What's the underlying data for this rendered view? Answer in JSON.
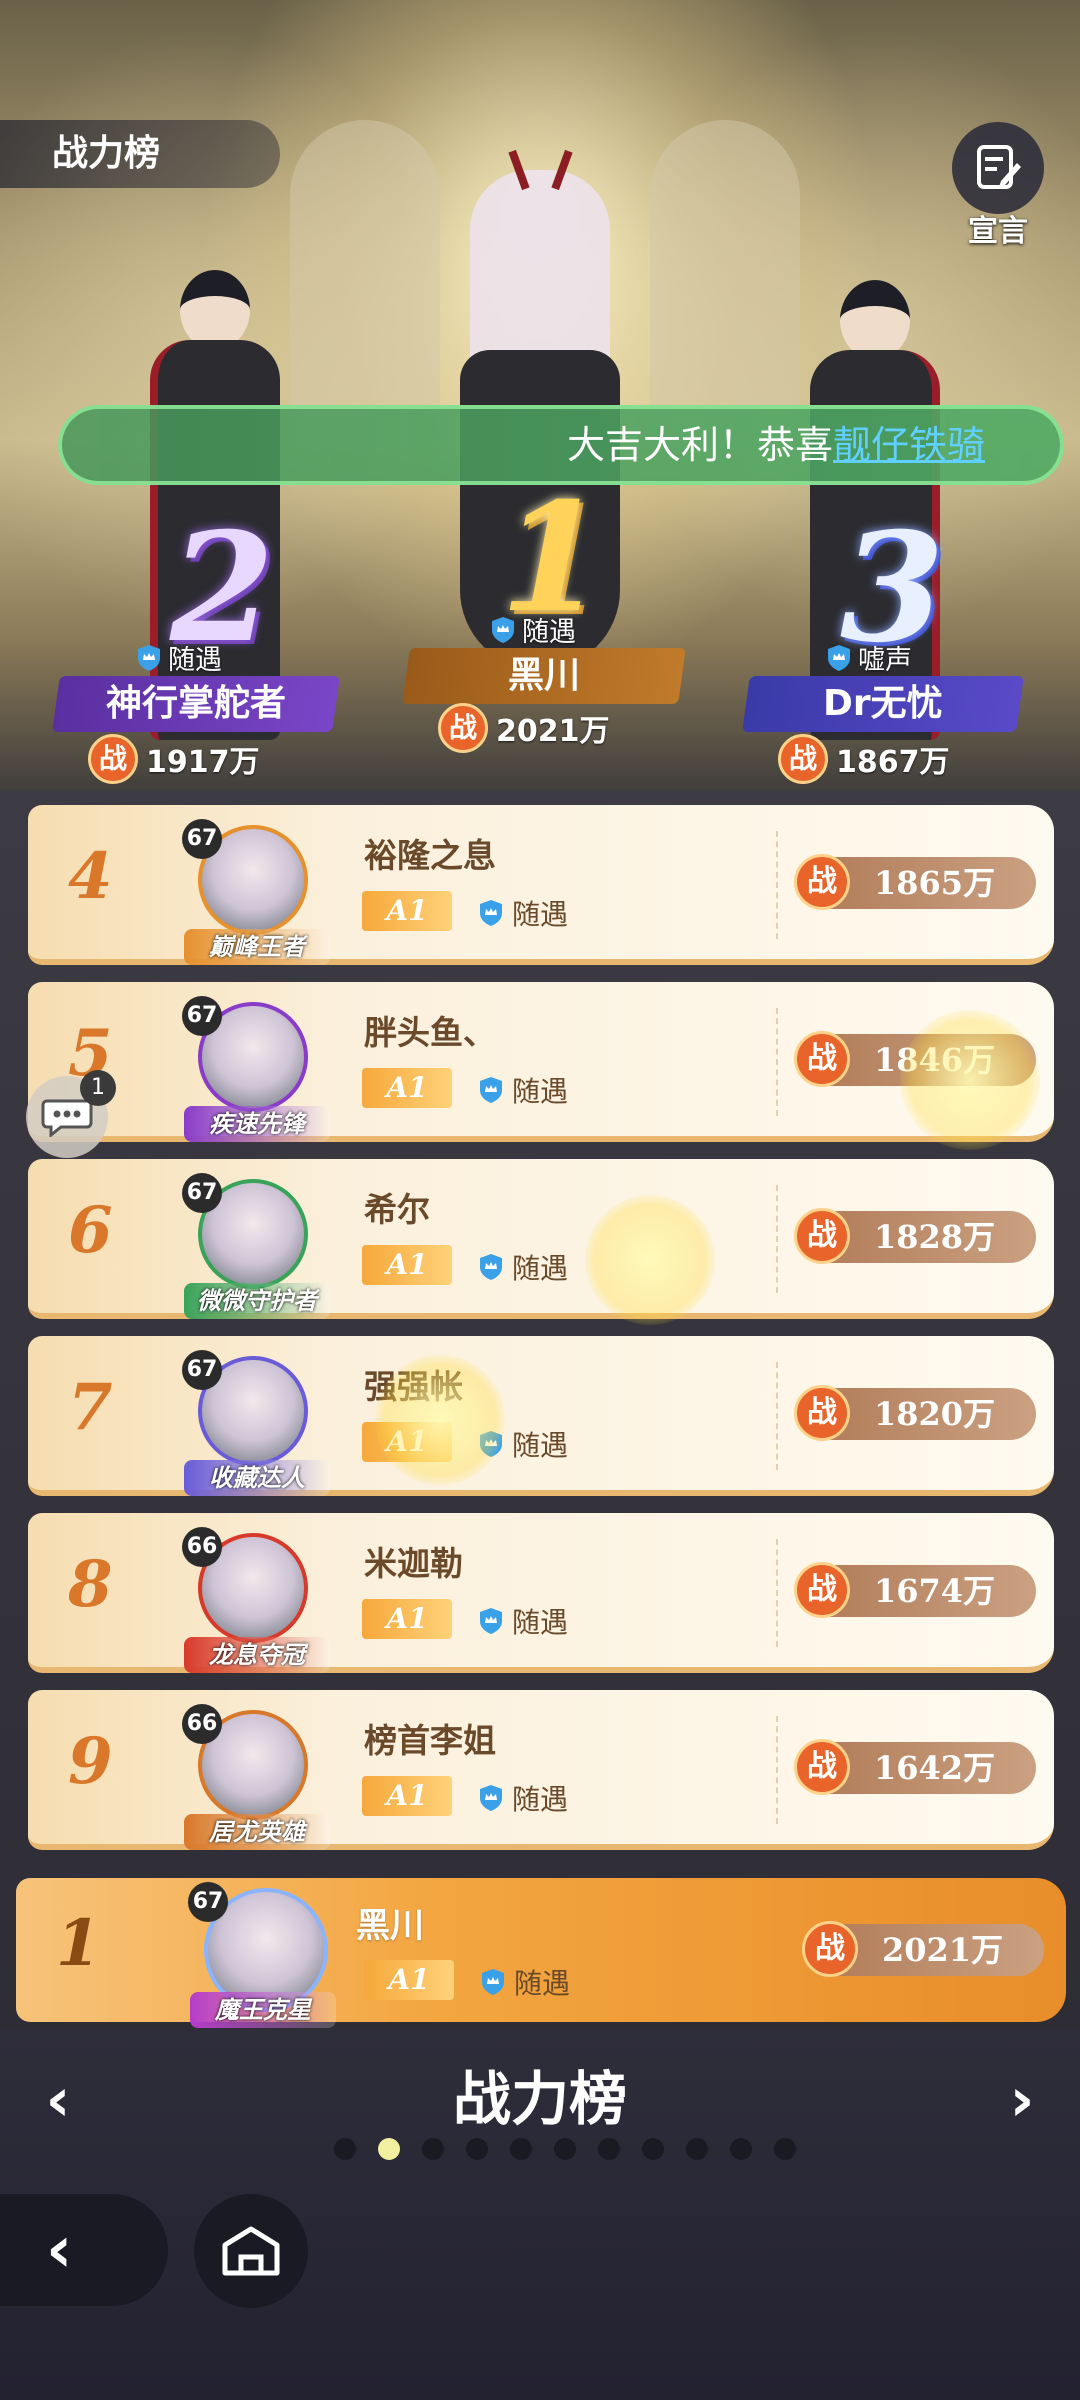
{
  "header": {
    "title": "战力榜",
    "declare_label": "宣言"
  },
  "marquee": {
    "prefix": "大吉大利！恭喜",
    "name": "靓仔铁骑"
  },
  "podium": [
    {
      "rank": "2",
      "name": "神行掌舵者",
      "tag": "随遇",
      "power": "1917万"
    },
    {
      "rank": "1",
      "name": "黑川",
      "tag": "随遇",
      "power": "2021万"
    },
    {
      "rank": "3",
      "name": "Dr无忧",
      "tag": "嘘声",
      "power": "1867万"
    }
  ],
  "power_char": "战",
  "rows": [
    {
      "rank": "4",
      "level": "67",
      "title": "巅峰王者",
      "name": "裕隆之息",
      "ai": "A1",
      "tag": "随遇",
      "power": "1865万",
      "title_color": "#e6902e"
    },
    {
      "rank": "5",
      "level": "67",
      "title": "疾速先锋",
      "name": "胖头鱼、",
      "ai": "A1",
      "tag": "随遇",
      "power": "1846万",
      "title_color": "#8a3cc9"
    },
    {
      "rank": "6",
      "level": "67",
      "title": "微微守护者",
      "name": "希尔",
      "ai": "A1",
      "tag": "随遇",
      "power": "1828万",
      "title_color": "#3aa35a"
    },
    {
      "rank": "7",
      "level": "67",
      "title": "收藏达人",
      "name": "强强帐",
      "ai": "A1",
      "tag": "随遇",
      "power": "1820万",
      "title_color": "#6a5cd8"
    },
    {
      "rank": "8",
      "level": "66",
      "title": "龙息夺冠",
      "name": "米迦勒",
      "ai": "A1",
      "tag": "随遇",
      "power": "1674万",
      "title_color": "#d83a2a"
    },
    {
      "rank": "9",
      "level": "66",
      "title": "居尤英雄",
      "name": "榜首李姐",
      "ai": "A1",
      "tag": "随遇",
      "power": "1642万",
      "title_color": "#d8782a"
    }
  ],
  "my_rank": {
    "rank": "1",
    "level": "67",
    "title": "魔王克星",
    "name": "黑川",
    "ai": "A1",
    "tag": "随遇",
    "power": "2021万",
    "title_color": "#b63cc9"
  },
  "chat_badge": "1",
  "bottom": {
    "title": "战力榜",
    "page_count": 11,
    "active_page": 1
  }
}
